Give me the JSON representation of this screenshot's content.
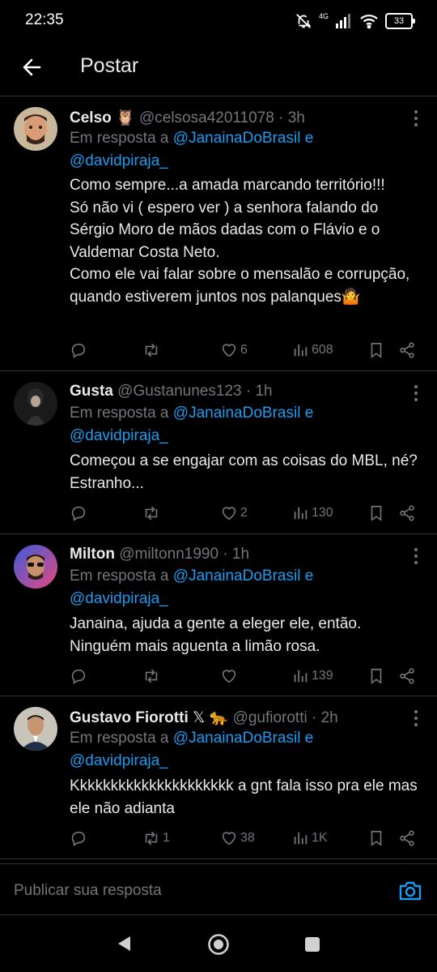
{
  "status": {
    "time": "22:35",
    "network": "4G",
    "battery": "33"
  },
  "header": {
    "title": "Postar"
  },
  "posts": [
    {
      "name": "Celso",
      "name_emoji": "🦉",
      "handle": "@celsosa42011078",
      "time": "3h",
      "reply_prefix": "Em resposta a",
      "reply_to_1": "@JanainaDoBrasil",
      "reply_and": "e",
      "reply_to_2": "@davidpiraja_",
      "text": "Como sempre...a amada marcando território!!!\nSó não vi ( espero ver ) a senhora falando do Sérgio Moro de mãos dadas com o Flávio e o Valdemar Costa Neto.\nComo ele vai falar sobre o mensalão e corrupção, quando estiverem juntos nos palanques🤷",
      "retweets": "",
      "likes": "6",
      "views": "608"
    },
    {
      "name": "Gusta",
      "name_emoji": "",
      "handle": "@Gustanunes123",
      "time": "1h",
      "reply_prefix": "Em resposta a",
      "reply_to_1": "@JanainaDoBrasil",
      "reply_and": "e",
      "reply_to_2": "@davidpiraja_",
      "text": "Começou a se engajar com as coisas do MBL, né? Estranho...",
      "retweets": "",
      "likes": "2",
      "views": "130"
    },
    {
      "name": "Milton",
      "name_emoji": "",
      "handle": "@miltonn1990",
      "time": "1h",
      "reply_prefix": "Em resposta a",
      "reply_to_1": "@JanainaDoBrasil",
      "reply_and": "e",
      "reply_to_2": "@davidpiraja_",
      "text": "Janaina, ajuda a gente a eleger ele, então. Ninguém mais aguenta a limão rosa.",
      "retweets": "",
      "likes": "",
      "views": "139"
    },
    {
      "name": "Gustavo Fiorotti",
      "name_emoji": "𝕏 🐆",
      "handle": "@gufiorotti",
      "time": "2h",
      "reply_prefix": "Em resposta a",
      "reply_to_1": "@JanainaDoBrasil",
      "reply_and": "e",
      "reply_to_2": "@davidpiraja_",
      "text": "Kkkkkkkkkkkkkkkkkkkkk a gnt fala isso pra ele mas ele não adianta",
      "retweets": "1",
      "likes": "38",
      "views": "1K"
    }
  ],
  "composer": {
    "placeholder": "Publicar sua resposta"
  },
  "icons": {
    "back": "arrow-left-icon",
    "more": "more-vertical-icon",
    "reply": "reply-icon",
    "retweet": "retweet-icon",
    "like": "heart-icon",
    "views": "views-icon",
    "bookmark": "bookmark-icon",
    "share": "share-icon",
    "camera": "camera-icon"
  },
  "colors": {
    "background": "#000000",
    "accent": "#1d9bf0",
    "muted": "#71767b",
    "text": "#e7e9ea"
  }
}
